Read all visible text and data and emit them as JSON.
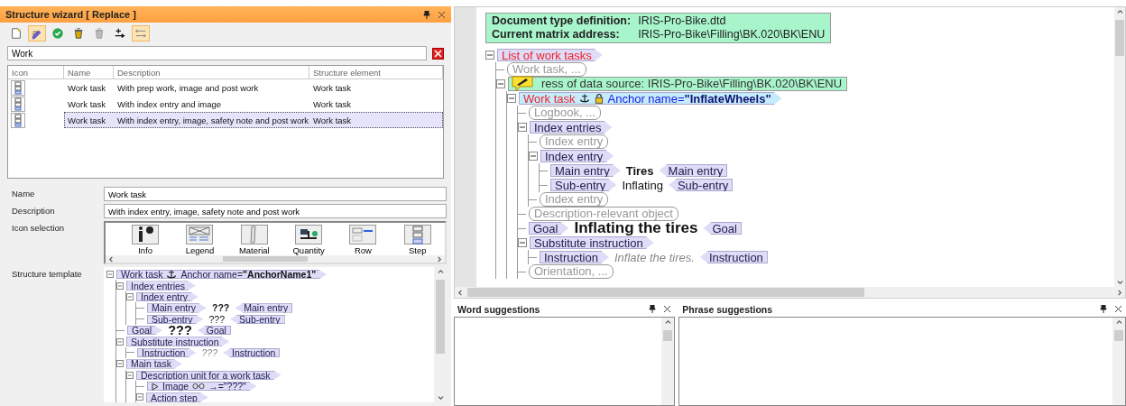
{
  "wizard": {
    "title": "Structure wizard [ Replace ]",
    "toolbar": [
      {
        "kind": "new",
        "selected": false
      },
      {
        "kind": "edit",
        "selected": true
      },
      {
        "kind": "apply",
        "selected": false
      },
      {
        "kind": "delete",
        "selected": false
      },
      {
        "kind": "delete-disabled",
        "selected": false
      },
      {
        "kind": "insert",
        "selected": false
      },
      {
        "kind": "swap",
        "selected": true
      }
    ],
    "search": {
      "value": "Work"
    },
    "table": {
      "columns": [
        "Icon",
        "Name",
        "Description",
        "Structure element"
      ],
      "rows": [
        {
          "name": "Work task",
          "description": "With prep work, image and post work",
          "structure_element": "Work task",
          "selected": false
        },
        {
          "name": "Work task",
          "description": "With index entry and image",
          "structure_element": "Work task",
          "selected": false
        },
        {
          "name": "Work task",
          "description": "With index entry, image, safety note and post work",
          "structure_element": "Work task",
          "selected": true
        }
      ]
    },
    "form": {
      "name_label": "Name",
      "name_value": "Work task",
      "description_label": "Description",
      "description_value": "With index entry, image, safety note and post work",
      "icon_selection_label": "Icon selection",
      "icons": [
        {
          "kind": "info",
          "label": "Info"
        },
        {
          "kind": "legend",
          "label": "Legend"
        },
        {
          "kind": "material",
          "label": "Material"
        },
        {
          "kind": "quantity",
          "label": "Quantity"
        },
        {
          "kind": "row",
          "label": "Row"
        },
        {
          "kind": "step",
          "label": "Step"
        }
      ],
      "template_label": "Structure template",
      "template": [
        {
          "kind": "element",
          "label": "Work task",
          "anchored": true,
          "attribute": "Anchor name=**\"AnchorName1\"**",
          "expanded": true,
          "children": [
            {
              "kind": "element",
              "label": "Index entries",
              "expanded": true,
              "children": [
                {
                  "kind": "element",
                  "label": "Index entry",
                  "expanded": true,
                  "children": [
                    {
                      "kind": "element",
                      "label": "Main entry",
                      "text": "???",
                      "bold": true,
                      "end_label": "Main entry"
                    },
                    {
                      "kind": "element",
                      "label": "Sub-entry",
                      "text": "???",
                      "bold": false,
                      "end_label": "Sub-entry"
                    }
                  ]
                }
              ]
            },
            {
              "kind": "element",
              "label": "Goal",
              "text": "???",
              "bold": true,
              "large": true,
              "end_label": "Goal"
            },
            {
              "kind": "element",
              "label": "Substitute instruction",
              "expanded": true,
              "children": [
                {
                  "kind": "element",
                  "label": "Instruction",
                  "text": "???",
                  "italic": true,
                  "end_label": "Instruction"
                }
              ]
            },
            {
              "kind": "element",
              "label": "Main task",
              "expanded": true,
              "children": [
                {
                  "kind": "element",
                  "label": "Description unit for a work task",
                  "expanded": true,
                  "children": [
                    {
                      "kind": "element",
                      "label": "Image",
                      "collapsible": true,
                      "linked": true,
                      "attribute": "→=\"???\""
                    },
                    {
                      "kind": "element",
                      "label": "Action step",
                      "expanded": true
                    }
                  ]
                }
              ]
            }
          ]
        }
      ]
    }
  },
  "editor": {
    "header": {
      "dtd_label": "Document type definition:",
      "dtd_value": "IRIS-Pro-Bike.dtd",
      "address_label": "Current matrix address:",
      "address_value": "IRIS-Pro-Bike\\Filling\\BK.020\\BK\\ENU"
    },
    "tree": [
      {
        "kind": "element",
        "label": "List of work tasks",
        "color": "#f0202c",
        "expanded": true,
        "selected": false,
        "children": [
          {
            "kind": "placeholder",
            "label": "Work task, ...",
            "selected": false
          },
          {
            "kind": "info",
            "text": "ress of data source: IRIS-Pro-Bike\\Filling\\BK.020\\BK\\ENU",
            "has_comment": true,
            "expanded": true,
            "selected": false,
            "children": [
              {
                "kind": "element",
                "label": "Work task",
                "color": "#f0202c",
                "anchored": true,
                "locked": true,
                "attribute": "Anchor name=**\"InflateWheels\"**",
                "selected": true,
                "expanded": true,
                "children": [
                  {
                    "kind": "placeholder",
                    "label": "Logbook, ...",
                    "selected": false
                  },
                  {
                    "kind": "element",
                    "label": "Index entries",
                    "expanded": true,
                    "selected": false,
                    "children": [
                      {
                        "kind": "placeholder",
                        "label": "Index entry",
                        "selected": false
                      },
                      {
                        "kind": "element",
                        "label": "Index entry",
                        "expanded": true,
                        "selected": false,
                        "children": [
                          {
                            "kind": "element",
                            "label": "Main entry",
                            "text": "Tires",
                            "bold": true,
                            "end_label": "Main entry",
                            "selected": false
                          },
                          {
                            "kind": "element",
                            "label": "Sub-entry",
                            "text": "Inflating",
                            "bold": false,
                            "end_label": "Sub-entry",
                            "selected": false
                          }
                        ]
                      },
                      {
                        "kind": "placeholder",
                        "label": "Index entry",
                        "selected": false
                      }
                    ]
                  },
                  {
                    "kind": "placeholder",
                    "label": "Description-relevant object",
                    "selected": false
                  },
                  {
                    "kind": "element",
                    "label": "Goal",
                    "text": "Inflating the tires",
                    "bold": true,
                    "large": true,
                    "end_label": "Goal",
                    "selected": false
                  },
                  {
                    "kind": "element",
                    "label": "Substitute instruction",
                    "expanded": true,
                    "selected": false,
                    "children": [
                      {
                        "kind": "element",
                        "label": "Instruction",
                        "text": "Inflate the tires.",
                        "italic": true,
                        "end_label": "Instruction",
                        "selected": false
                      }
                    ]
                  },
                  {
                    "kind": "placeholder",
                    "label": "Orientation, ...",
                    "selected": false
                  }
                ]
              }
            ]
          }
        ]
      }
    ]
  },
  "panes": [
    {
      "title": "Word suggestions"
    },
    {
      "title": "Phrase suggestions"
    }
  ]
}
